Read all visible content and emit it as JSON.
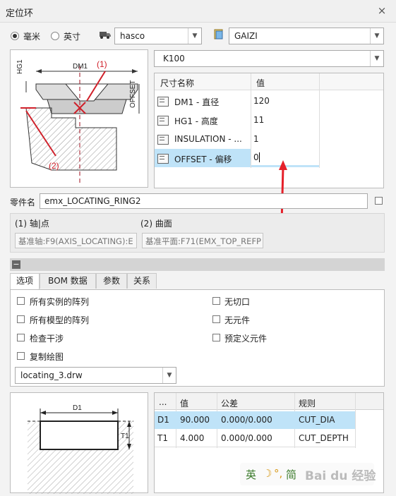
{
  "window": {
    "title": "定位环",
    "close": "×"
  },
  "units": {
    "mm": "毫米",
    "inch": "英寸",
    "selected": "mm"
  },
  "supplier": {
    "value": "hasco"
  },
  "model": {
    "value": "GAIZI"
  },
  "size": {
    "value": "K100"
  },
  "diagram_top": {
    "dm1": "DM1",
    "hg1": "HG1",
    "offset": "OFFSET",
    "ref1": "(1)",
    "ref2": "(2)"
  },
  "dim_table": {
    "headers": [
      "尺寸名称",
      "值"
    ],
    "rows": [
      {
        "name": "DM1 - 直径",
        "value": "120"
      },
      {
        "name": "HG1 - 高度",
        "value": "11"
      },
      {
        "name": "INSULATION - ...",
        "value": "1"
      },
      {
        "name": "OFFSET - 偏移",
        "value": "0"
      }
    ]
  },
  "part_name": {
    "label": "零件名",
    "value": "emx_LOCATING_RING2"
  },
  "refs": {
    "axis_label": "(1) 轴|点",
    "axis_value": "基准轴:F9(AXIS_LOCATING):E",
    "surface_label": "(2) 曲面",
    "surface_value": "基准平面:F71(EMX_TOP_REFP"
  },
  "collapse": {
    "icon": "minus-icon"
  },
  "tabs": [
    "选项",
    "BOM 数据",
    "参数",
    "关系"
  ],
  "options": {
    "left": [
      "所有实例的阵列",
      "所有模型的阵列",
      "检查干涉",
      "复制绘图"
    ],
    "right": [
      "无切口",
      "无元件",
      "预定义元件"
    ],
    "drawing": "locating_3.drw"
  },
  "diagram_bottom": {
    "d1": "D1",
    "t1": "T1"
  },
  "tol_table": {
    "headers": [
      "...",
      "值",
      "公差",
      "规则"
    ],
    "rows": [
      {
        "name": "D1",
        "value": "90.000",
        "tol": "0.000/0.000",
        "rule": "CUT_DIA"
      },
      {
        "name": "T1",
        "value": "4.000",
        "tol": "0.000/0.000",
        "rule": "CUT_DEPTH"
      }
    ]
  },
  "ime": {
    "lang": "英",
    "mode": "简",
    "brand": "Bai du 经验"
  },
  "colors": {
    "selection": "#bfe3f8",
    "annotation": "#d0202a"
  }
}
